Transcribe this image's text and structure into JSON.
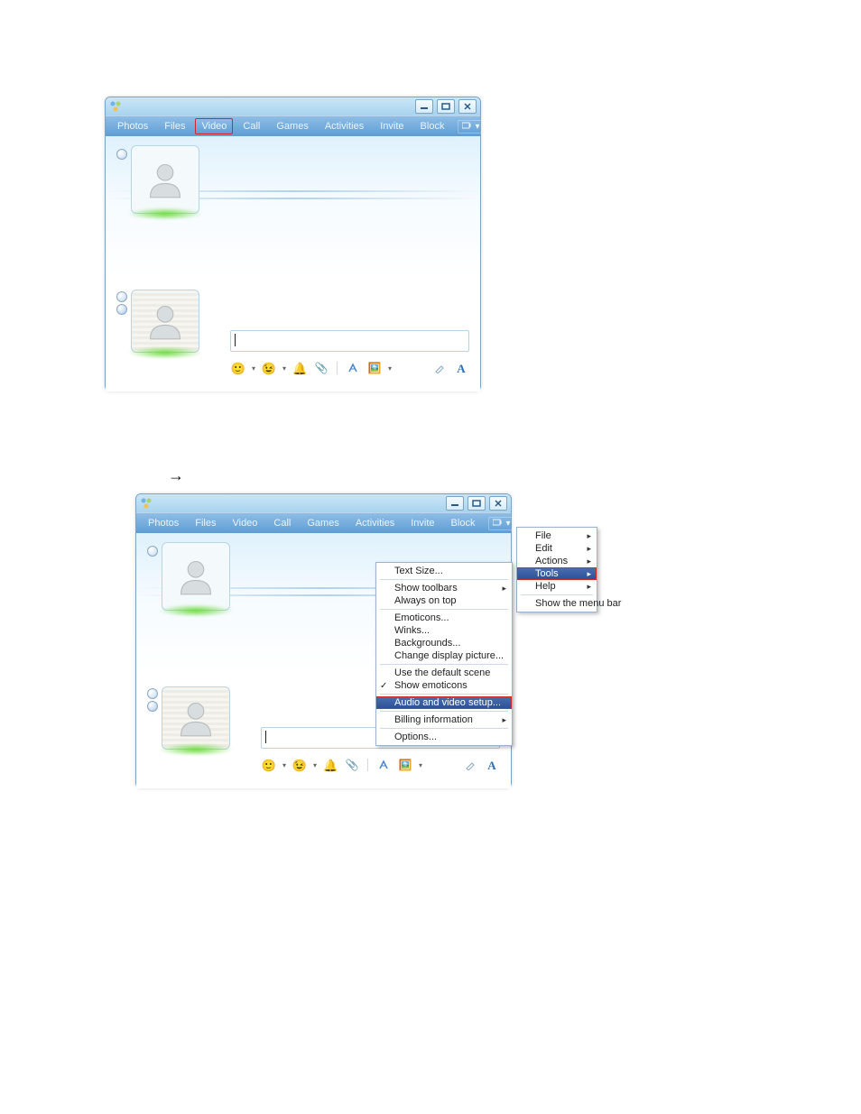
{
  "screenshot1": {
    "menubar": [
      "Photos",
      "Files",
      "Video",
      "Call",
      "Games",
      "Activities",
      "Invite",
      "Block"
    ],
    "highlight_index": 2
  },
  "screenshot2": {
    "menubar": [
      "Photos",
      "Files",
      "Video",
      "Call",
      "Games",
      "Activities",
      "Invite",
      "Block"
    ],
    "main_menu": {
      "items": [
        "File",
        "Edit",
        "Actions",
        "Tools",
        "Help"
      ],
      "show_menu_bar": "Show the menu bar",
      "selected_index": 3
    },
    "tools_menu": {
      "text_size": "Text Size...",
      "show_toolbars": "Show toolbars",
      "always_on_top": "Always on top",
      "emoticons": "Emoticons...",
      "winks": "Winks...",
      "backgrounds": "Backgrounds...",
      "change_display_picture": "Change display picture...",
      "use_default_scene": "Use the default scene",
      "show_emoticons": "Show emoticons",
      "audio_video_setup": "Audio and video setup...",
      "billing_information": "Billing information",
      "options": "Options..."
    }
  },
  "arrow": "→"
}
